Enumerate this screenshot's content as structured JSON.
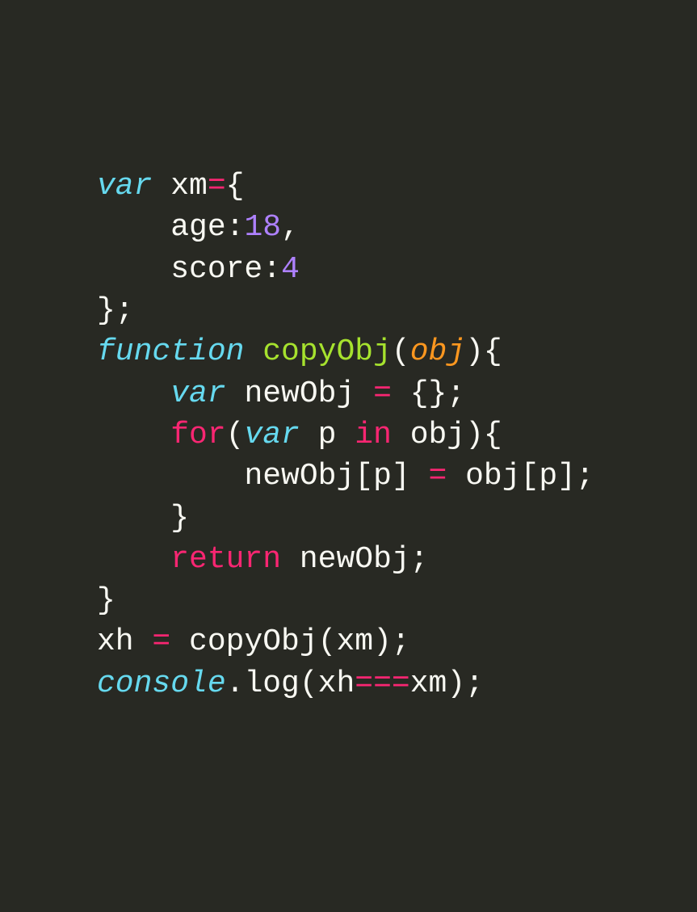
{
  "code": {
    "bg": "#282923",
    "lines": [
      {
        "indent": "",
        "tokens": [
          {
            "t": "var ",
            "c": "keyword-italic"
          },
          {
            "t": "xm",
            "c": "string-white"
          },
          {
            "t": "=",
            "c": "keyword-red"
          },
          {
            "t": "{",
            "c": "punc"
          }
        ]
      },
      {
        "indent": "    ",
        "tokens": [
          {
            "t": "age",
            "c": "string-white"
          },
          {
            "t": ":",
            "c": "punc"
          },
          {
            "t": "18",
            "c": "number-purple"
          },
          {
            "t": ",",
            "c": "punc"
          }
        ]
      },
      {
        "indent": "    ",
        "tokens": [
          {
            "t": "score",
            "c": "string-white"
          },
          {
            "t": ":",
            "c": "punc"
          },
          {
            "t": "4",
            "c": "number-purple"
          }
        ]
      },
      {
        "indent": "",
        "tokens": [
          {
            "t": "};",
            "c": "punc"
          }
        ]
      },
      {
        "indent": "",
        "tokens": [
          {
            "t": "function ",
            "c": "keyword-italic"
          },
          {
            "t": "copyObj",
            "c": "func-name"
          },
          {
            "t": "(",
            "c": "punc"
          },
          {
            "t": "obj",
            "c": "param-orange"
          },
          {
            "t": "){",
            "c": "punc"
          }
        ]
      },
      {
        "indent": "    ",
        "tokens": [
          {
            "t": "var ",
            "c": "keyword-italic"
          },
          {
            "t": "newObj ",
            "c": "string-white"
          },
          {
            "t": "=",
            "c": "keyword-red"
          },
          {
            "t": " {};",
            "c": "punc"
          }
        ]
      },
      {
        "indent": "    ",
        "tokens": [
          {
            "t": "for",
            "c": "keyword-red"
          },
          {
            "t": "(",
            "c": "punc"
          },
          {
            "t": "var ",
            "c": "keyword-italic"
          },
          {
            "t": "p ",
            "c": "string-white"
          },
          {
            "t": "in",
            "c": "keyword-red"
          },
          {
            "t": " obj){",
            "c": "punc"
          }
        ]
      },
      {
        "indent": "        ",
        "tokens": [
          {
            "t": "newObj[p] ",
            "c": "string-white"
          },
          {
            "t": "=",
            "c": "keyword-red"
          },
          {
            "t": " obj[p];",
            "c": "punc"
          }
        ]
      },
      {
        "indent": "    ",
        "tokens": [
          {
            "t": "}",
            "c": "punc"
          }
        ]
      },
      {
        "indent": "    ",
        "tokens": [
          {
            "t": "return",
            "c": "keyword-red"
          },
          {
            "t": " newObj;",
            "c": "punc"
          }
        ]
      },
      {
        "indent": "",
        "tokens": [
          {
            "t": "}",
            "c": "punc"
          }
        ]
      },
      {
        "indent": "",
        "tokens": [
          {
            "t": "xh ",
            "c": "string-white"
          },
          {
            "t": "=",
            "c": "keyword-red"
          },
          {
            "t": " copyObj(xm);",
            "c": "punc"
          }
        ]
      },
      {
        "indent": "",
        "tokens": [
          {
            "t": "console",
            "c": "keyword-italic"
          },
          {
            "t": ".",
            "c": "punc"
          },
          {
            "t": "log",
            "c": "string-white"
          },
          {
            "t": "(xh",
            "c": "punc"
          },
          {
            "t": "===",
            "c": "keyword-red"
          },
          {
            "t": "xm);",
            "c": "punc"
          }
        ]
      }
    ]
  }
}
